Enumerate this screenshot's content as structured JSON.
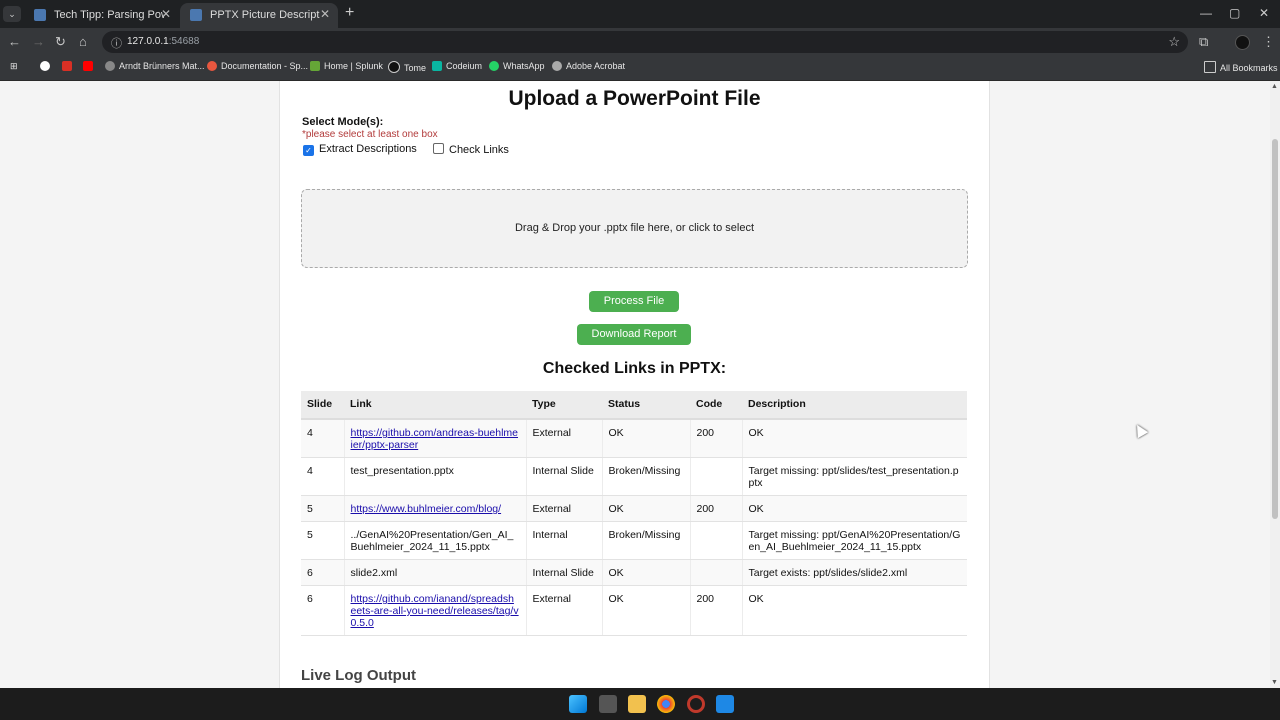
{
  "browser": {
    "tabs": [
      {
        "title": "Tech Tipp: Parsing PowerPoint F"
      },
      {
        "title": "PPTX Picture Description Extrac"
      }
    ],
    "url_host": "127.0.0.1",
    "url_port": ":54688",
    "bookmarks": [
      "Arndt Brünners Mat...",
      "Documentation - Sp...",
      "Home | Splunk",
      "Tome",
      "Codeium",
      "WhatsApp",
      "Adobe Acrobat"
    ],
    "all_bookmarks": "All Bookmarks"
  },
  "page": {
    "title": "Upload a PowerPoint File",
    "mode_title": "Select Mode(s):",
    "mode_hint": "*please select at least one box",
    "modes": [
      {
        "label": "Extract Descriptions",
        "checked": true
      },
      {
        "label": "Check Links",
        "checked": false
      }
    ],
    "dropzone_text": "Drag & Drop your .pptx file here, or click to select",
    "process_button": "Process File",
    "download_button": "Download Report",
    "links_heading": "Checked Links in PPTX:",
    "columns": [
      "Slide",
      "Link",
      "Type",
      "Status",
      "Code",
      "Description"
    ],
    "rows": [
      {
        "slide": "4",
        "link": "https://github.com/andreas-buehlmeier/pptx-parser",
        "is_url": true,
        "type": "External",
        "status": "OK",
        "code": "200",
        "description": "OK"
      },
      {
        "slide": "4",
        "link": "test_presentation.pptx",
        "is_url": false,
        "type": "Internal Slide",
        "status": "Broken/Missing",
        "code": "",
        "description": "Target missing: ppt/slides/test_presentation.pptx"
      },
      {
        "slide": "5",
        "link": "https://www.buhlmeier.com/blog/",
        "is_url": true,
        "type": "External",
        "status": "OK",
        "code": "200",
        "description": "OK"
      },
      {
        "slide": "5",
        "link": "../GenAI%20Presentation/Gen_AI_Buehlmeier_2024_11_15.pptx",
        "is_url": false,
        "type": "Internal",
        "status": "Broken/Missing",
        "code": "",
        "description": "Target missing: ppt/GenAI%20Presentation/Gen_AI_Buehlmeier_2024_11_15.pptx"
      },
      {
        "slide": "6",
        "link": "slide2.xml",
        "is_url": false,
        "type": "Internal Slide",
        "status": "OK",
        "code": "",
        "description": "Target exists: ppt/slides/slide2.xml"
      },
      {
        "slide": "6",
        "link": "https://github.com/ianand/spreadsheets-are-all-you-need/releases/tag/v0.5.0",
        "is_url": true,
        "type": "External",
        "status": "OK",
        "code": "200",
        "description": "OK"
      }
    ],
    "live_log_heading": "Live Log Output"
  }
}
